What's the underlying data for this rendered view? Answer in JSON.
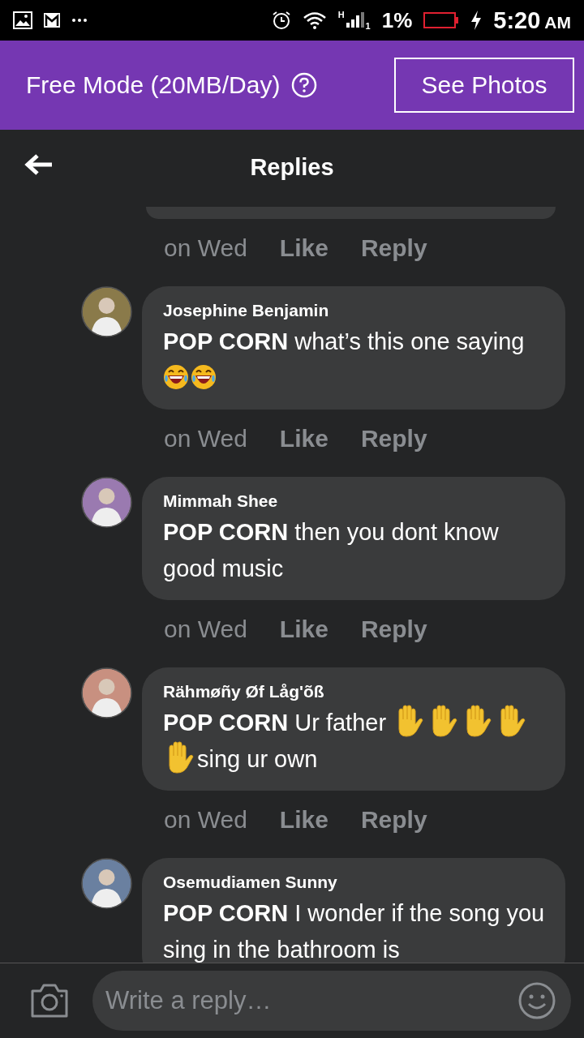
{
  "status_bar": {
    "network": "H",
    "sim": "1",
    "battery": "1%",
    "time": "5:20",
    "meridiem": "AM"
  },
  "banner": {
    "title": "Free Mode (20MB/Day)",
    "button": "See Photos"
  },
  "header": {
    "title": "Replies"
  },
  "previous_actions": {
    "time": "on Wed",
    "like": "Like",
    "reply": "Reply"
  },
  "comments": [
    {
      "author": "Josephine Benjamin",
      "tag": "POP CORN",
      "parts": [
        {
          "kind": "text",
          "text": " what’s this one saying "
        },
        {
          "kind": "laugh"
        },
        {
          "kind": "laugh"
        }
      ],
      "time": "on Wed",
      "like": "Like",
      "reply": "Reply"
    },
    {
      "author": "Mimmah Shee",
      "tag": "POP CORN",
      "parts": [
        {
          "kind": "text",
          "text": " then you dont know good music"
        }
      ],
      "time": "on Wed",
      "like": "Like",
      "reply": "Reply"
    },
    {
      "author": "Rähmøñy Øf Låg'õß",
      "tag": "POP CORN",
      "parts": [
        {
          "kind": "text",
          "text": " Ur father "
        },
        {
          "kind": "hand"
        },
        {
          "kind": "hand"
        },
        {
          "kind": "hand"
        },
        {
          "kind": "hand"
        },
        {
          "kind": "hand"
        },
        {
          "kind": "text",
          "text": "sing ur own"
        }
      ],
      "time": "on Wed",
      "like": "Like",
      "reply": "Reply"
    },
    {
      "author": "Osemudiamen Sunny",
      "tag": "POP CORN",
      "parts": [
        {
          "kind": "text",
          "text": " I wonder if the song you sing in the bathroom is"
        }
      ]
    }
  ],
  "composer": {
    "placeholder": "Write a reply…"
  }
}
